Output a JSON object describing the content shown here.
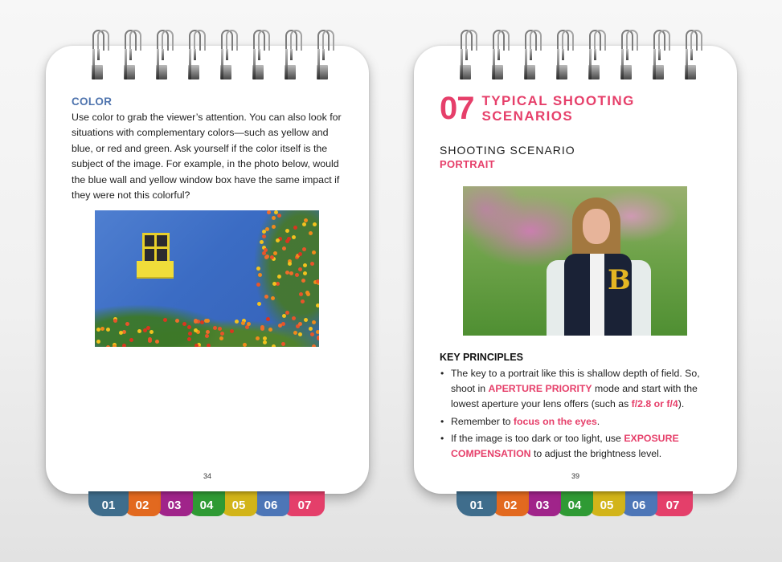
{
  "tabs": [
    {
      "label": "01",
      "color": "#3f6d8c"
    },
    {
      "label": "02",
      "color": "#e2691f"
    },
    {
      "label": "03",
      "color": "#a0248a"
    },
    {
      "label": "04",
      "color": "#2f9a34"
    },
    {
      "label": "05",
      "color": "#d2b419"
    },
    {
      "label": "06",
      "color": "#4d76b7"
    },
    {
      "label": "07",
      "color": "#e43f6a"
    }
  ],
  "left_page": {
    "section_heading": "COLOR",
    "body": "Use color to grab the viewer’s attention. You can also look for situations with complementary colors—such as yellow and blue, or red and green. Ask yourself if the color itself is the subject of the image. For example, in the photo below, would the blue wall and yellow window box have the same impact if they were not this colorful?",
    "photo_alt": "Blue wall with yellow window box and orange flowers",
    "page_number": "34"
  },
  "right_page": {
    "chapter_number": "07",
    "chapter_title_line1": "TYPICAL SHOOTING",
    "chapter_title_line2": "SCENARIOS",
    "scenario_label": "SHOOTING SCENARIO",
    "scenario_name": "PORTRAIT",
    "photo_alt": "Portrait of a smiling young woman in a varsity jacket with shallow depth of field",
    "principles_heading": "KEY PRINCIPLES",
    "bullets": [
      {
        "t1": "The key to a portrait like this is shallow depth of field. So, shoot in ",
        "h1": "APERTURE PRIORITY",
        "t2": " mode and start with the lowest aperture your lens offers (such as ",
        "h2": "f/2.8 or f/4",
        "t3": ")."
      },
      {
        "t1": "Remember to ",
        "h1": "focus on the eyes",
        "t2": "."
      },
      {
        "t1": "If the image is too dark or too light, use ",
        "h1": "EXPOSURE COMPENSATION",
        "t2": " to adjust the brightness level."
      }
    ],
    "page_number": "39"
  },
  "accent_color": "#e63f6a",
  "heading_blue": "#4f74ae"
}
